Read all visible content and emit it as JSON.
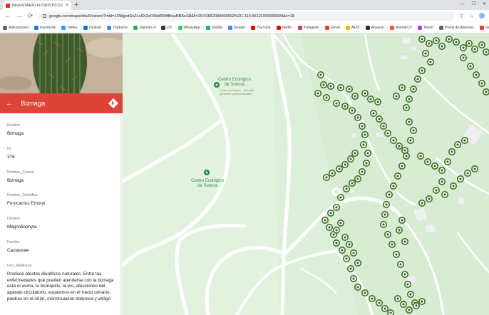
{
  "browser": {
    "tab_title": "INVENTARIO FLORISTICO CES - ...",
    "tab_close": "×",
    "new_tab": "+",
    "url": "google.com/maps/d/u/0/viewer?mid=1SWgcdSxZLu5X2cFRkMRMfBtsaNBKuS8&ll=29.01662000000002%2C-110.95121099999999&z=18",
    "nav": {
      "back": "←",
      "forward": "→",
      "reload": "⟳"
    },
    "bookmarks": [
      {
        "label": "Aplicaciones",
        "color": "#5f6368"
      },
      {
        "label": "Facebook",
        "color": "#1877f2"
      },
      {
        "label": "Twitter",
        "color": "#1da1f2"
      },
      {
        "label": "Outlook",
        "color": "#0078d4"
      },
      {
        "label": "Traductor",
        "color": "#4285f4"
      },
      {
        "label": "Japonés 4",
        "color": "#34a853"
      },
      {
        "label": "DC",
        "color": "#333333"
      },
      {
        "label": "WhatsApp",
        "color": "#25d366"
      },
      {
        "label": "Spotify",
        "color": "#1db954"
      },
      {
        "label": "Google",
        "color": "#4285f4"
      },
      {
        "label": "YouTube",
        "color": "#ff0000"
      },
      {
        "label": "Netflix",
        "color": "#e50914"
      },
      {
        "label": "Instagram",
        "color": "#c13584"
      },
      {
        "label": "Gmail",
        "color": "#ea4335"
      },
      {
        "label": "AEDI",
        "color": "#f4b400"
      },
      {
        "label": "Amazon",
        "color": "#232f3e"
      },
      {
        "label": "AnimeFLV",
        "color": "#ff5722"
      },
      {
        "label": "Twitch",
        "color": "#9146ff"
      },
      {
        "label": "Portal de Alumnos",
        "color": "#5f6368"
      },
      {
        "label": "GetComics",
        "color": "#e53935"
      }
    ]
  },
  "panel": {
    "title": "Biznaga",
    "accent_color": "#db4437",
    "fields": [
      {
        "label": "Nombre",
        "value": "Biznaga"
      },
      {
        "label": "ID",
        "value": "376"
      },
      {
        "label": "Nombre_Comun",
        "value": "Biznaga"
      },
      {
        "label": "Nombre_Cientifico",
        "value": "Ferocactus Emoryi"
      },
      {
        "label": "Division",
        "value": "Magnoliophyta"
      },
      {
        "label": "Familia",
        "value": "Cactaceae"
      },
      {
        "label": "Uso_Medicinal",
        "value": "Produce efectos diuréticos naturales. Entre las enfermedades que pueden atenderse con la biznaga está el asma, la bronquitis, la tos, afecciones del aparato circulatorio, espasmos en el tracto urinario, piedras en el riñón, menstruación dolorosa y vitiligo"
      }
    ]
  },
  "map": {
    "poi_top": {
      "name": "Centro Ecológico de Sonora",
      "sub": "Centro ecológico · Anímate aprender, sobre animales"
    },
    "poi_mid": {
      "name": "Centro Ecológico de Sonora"
    },
    "marker_color": "#3b6e22"
  }
}
